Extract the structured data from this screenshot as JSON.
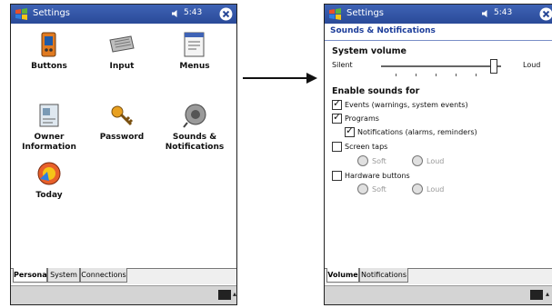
{
  "left_screen": {
    "title": "Settings",
    "time": "5:43",
    "icons": [
      {
        "label": "Buttons",
        "icon": "buttons-icon"
      },
      {
        "label": "Input",
        "icon": "keyboard-icon"
      },
      {
        "label": "Menus",
        "icon": "menus-icon"
      },
      {
        "label": "Owner Information",
        "icon": "owner-info-icon"
      },
      {
        "label": "Password",
        "icon": "key-icon"
      },
      {
        "label": "Sounds & Notifications",
        "icon": "speaker-icon"
      },
      {
        "label": "Today",
        "icon": "today-icon"
      }
    ],
    "tabs": [
      "Personal",
      "System",
      "Connections"
    ]
  },
  "right_screen": {
    "title": "Settings",
    "time": "5:43",
    "page_title": "Sounds & Notifications",
    "system_volume_label": "System volume",
    "slider_min_label": "Silent",
    "slider_max_label": "Loud",
    "volume_level": 0.93,
    "enable_sounds_label": "Enable sounds for",
    "options": {
      "events": {
        "label": "Events (warnings, system events)",
        "checked": true
      },
      "programs": {
        "label": "Programs",
        "checked": true
      },
      "notifications": {
        "label": "Notifications (alarms, reminders)",
        "checked": true
      },
      "screen_taps": {
        "label": "Screen taps",
        "checked": false
      },
      "hardware_buttons": {
        "label": "Hardware buttons",
        "checked": false
      }
    },
    "radio_soft": "Soft",
    "radio_loud": "Loud",
    "tabs": [
      "Volume",
      "Notifications"
    ]
  }
}
